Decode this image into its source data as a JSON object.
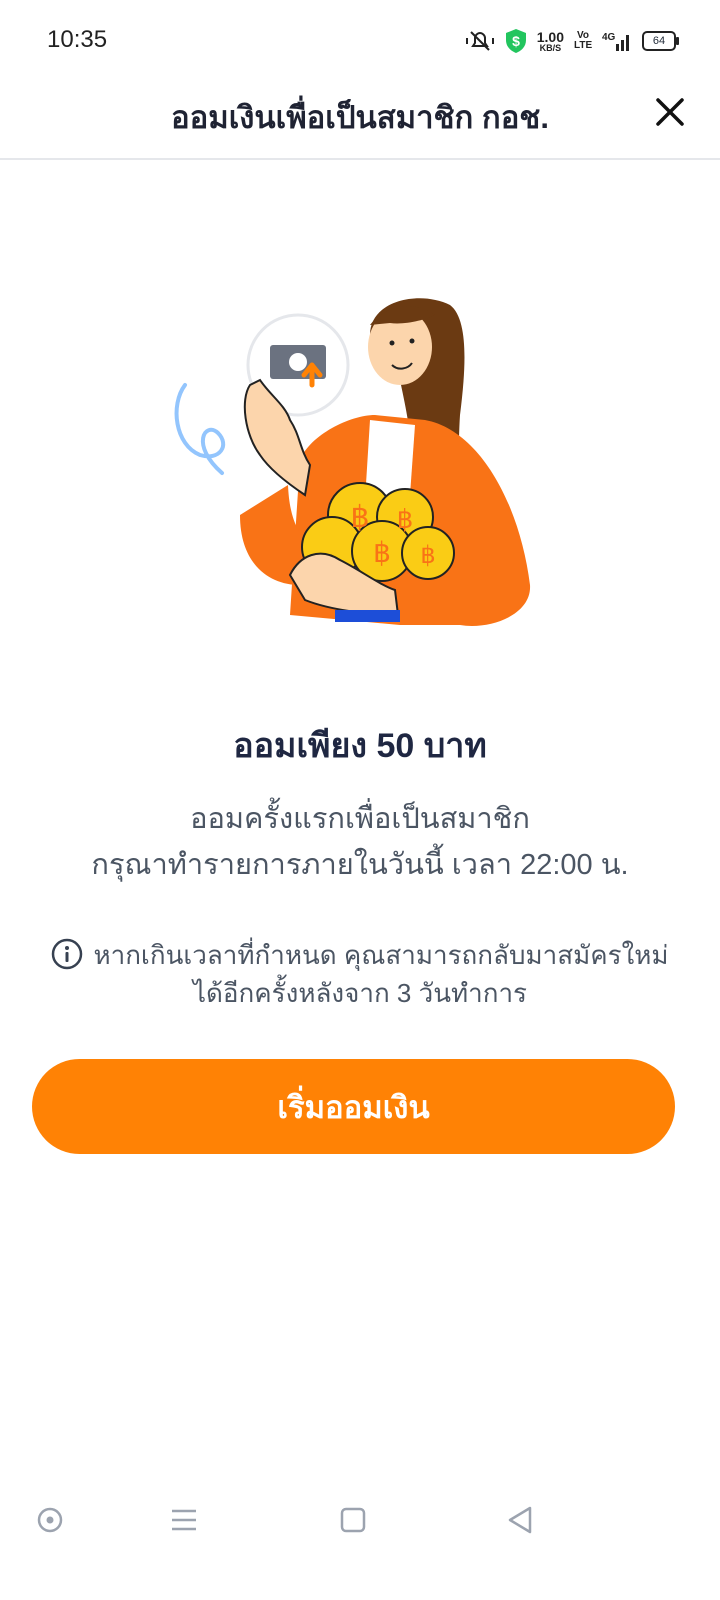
{
  "status_bar": {
    "time": "10:35",
    "net_speed_value": "1.00",
    "net_speed_unit": "KB/S",
    "volte_label": "Vo LTE",
    "network": "4G",
    "battery": "64"
  },
  "header": {
    "title": "ออมเงินเพื่อเป็นสมาชิก กอช.",
    "close_icon": "close-icon"
  },
  "illustration": {
    "description_icon": "woman-holding-coins-illustration",
    "coin_symbol": "฿"
  },
  "content": {
    "headline": "ออมเพียง 50 บาท",
    "desc_line1": "ออมครั้งแรกเพื่อเป็นสมาชิก",
    "desc_line2": "กรุณาทำรายการภายในวันนี้ เวลา 22:00 น.",
    "note_line1": "หากเกินเวลาที่กำหนด คุณสามารถกลับมาสมัครใหม่",
    "note_line2": "ได้อีกครั้งหลังจาก 3 วันทำการ"
  },
  "cta": {
    "label": "เริ่มออมเงิน"
  },
  "colors": {
    "accent": "#ff8205",
    "title": "#1f2742",
    "text": "#4b5563"
  }
}
